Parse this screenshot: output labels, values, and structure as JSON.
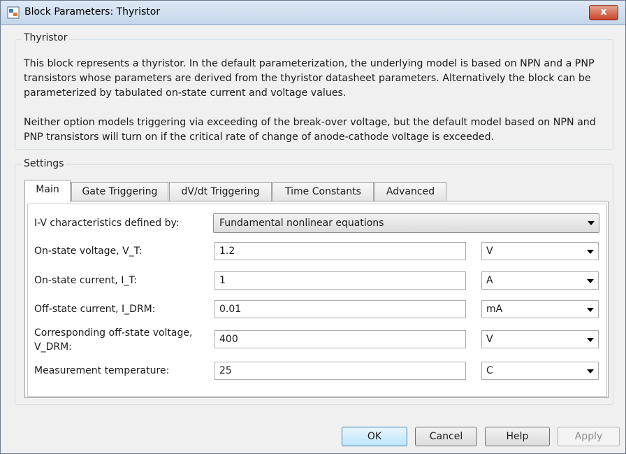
{
  "window": {
    "title": "Block Parameters: Thyristor",
    "close_label": "x"
  },
  "block_group": {
    "label": "Thyristor",
    "description": [
      "This block represents a thyristor. In the default parameterization, the underlying model is based on NPN and a PNP",
      "transistors whose parameters are derived from the thyristor datasheet parameters. Alternatively the block can be",
      "parameterized by tabulated on-state current and voltage values.",
      "",
      "Neither option models triggering via exceeding of the break-over voltage, but the default model based on NPN and",
      "PNP transistors will turn on if the critical rate of change of anode-cathode voltage is exceeded."
    ]
  },
  "settings": {
    "label": "Settings",
    "tabs": [
      "Main",
      "Gate Triggering",
      "dV/dt Triggering",
      "Time Constants",
      "Advanced"
    ],
    "active_tab": "Main",
    "iv_label": "I-V characteristics defined by:",
    "iv_value": "Fundamental nonlinear equations",
    "rows": [
      {
        "label": "On-state voltage, V_T:",
        "value": "1.2",
        "unit": "V"
      },
      {
        "label": "On-state current, I_T:",
        "value": "1",
        "unit": "A"
      },
      {
        "label": "Off-state current, I_DRM:",
        "value": "0.01",
        "unit": "mA"
      },
      {
        "label_line1": "Corresponding off-state voltage,",
        "label_line2": "V_DRM:",
        "value": "400",
        "unit": "V"
      },
      {
        "label": "Measurement temperature:",
        "value": "25",
        "unit": "C"
      }
    ]
  },
  "buttons": {
    "ok": "OK",
    "cancel": "Cancel",
    "help": "Help",
    "apply": "Apply"
  },
  "colors": {
    "titlebar": "#c4d6ec",
    "close": "#c8442a",
    "default_button": "#bee6fd"
  }
}
